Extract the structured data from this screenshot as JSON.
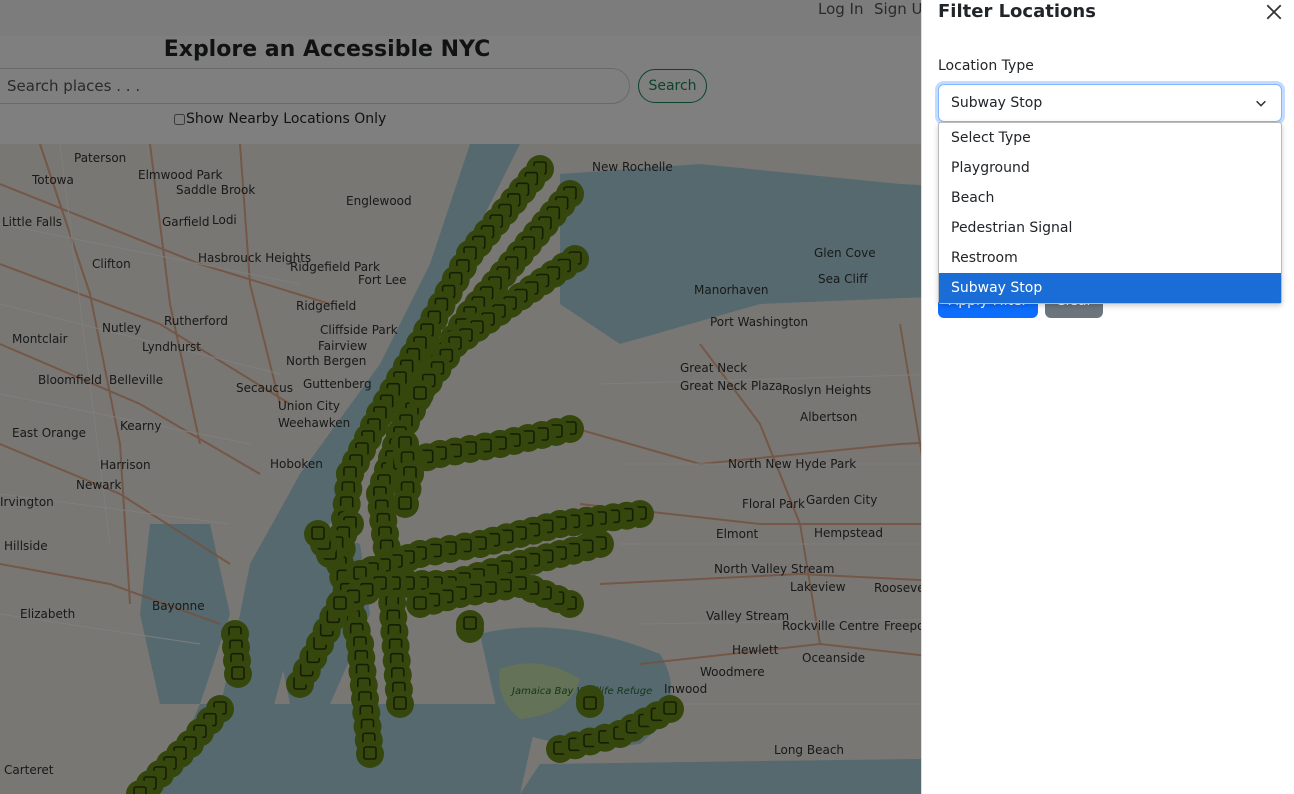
{
  "navbar": {
    "login_label": "Log In",
    "signup_label": "Sign Up"
  },
  "hero": {
    "title": "Explore an Accessible NYC"
  },
  "search": {
    "placeholder": "Search places . . .",
    "button_label": "Search",
    "nearby_label": "Show Nearby Locations Only",
    "nearby_checked": false
  },
  "map": {
    "place_labels": [
      "Paterson",
      "Totowa",
      "Elmwood Park",
      "Saddle Brook",
      "Englewood",
      "New Rochelle",
      "Little Falls",
      "Garfield",
      "Lodi",
      "Clifton",
      "Hasbrouck Heights",
      "Ridgefield Park",
      "Fort Lee",
      "Rutherford",
      "Nutley",
      "Lyndhurst",
      "Ridgefield",
      "Cliffside Park",
      "Fairview",
      "North Bergen",
      "Guttenberg",
      "Montclair",
      "Bloomfield",
      "Belleville",
      "Secaucus",
      "Union City",
      "Weehawken",
      "Kearny",
      "East Orange",
      "Harrison",
      "Hoboken",
      "Newark",
      "Irvington",
      "Hillside",
      "Elizabeth",
      "Bayonne",
      "Carteret",
      "Manorhaven",
      "Port Washington",
      "Great Neck",
      "Great Neck Plaza",
      "Roslyn Heights",
      "Albertson",
      "North New Hyde Park",
      "Floral Park",
      "Garden City",
      "Elmont",
      "Hempstead",
      "North Valley Stream",
      "Lakeview",
      "Valley Stream",
      "Rockville Centre",
      "Hewlett",
      "Oceanside",
      "Woodmere",
      "Inwood",
      "Long Beach",
      "Glen Cove",
      "Sea Cliff",
      "Roosevelt",
      "Freeport",
      "Jamaica Bay Wildlife Refuge"
    ],
    "marker_color": "#6b8e1a"
  },
  "filter_panel": {
    "title": "Filter Locations",
    "location_type_label": "Location Type",
    "selected_type": "Subway Stop",
    "options": [
      "Select Type",
      "Playground",
      "Beach",
      "Pedestrian Signal",
      "Restroom",
      "Subway Stop"
    ],
    "apply_label": "Apply Filter",
    "clear_label": "Clear"
  }
}
